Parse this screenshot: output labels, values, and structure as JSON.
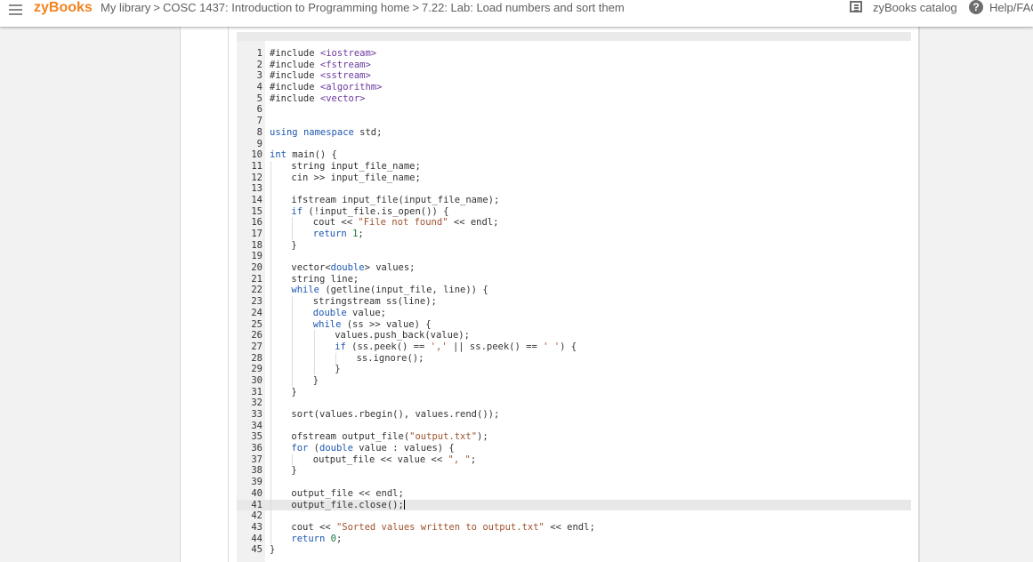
{
  "header": {
    "brand": "zyBooks",
    "breadcrumb": [
      {
        "label": "My library"
      },
      {
        "label": "COSC 1437: Introduction to Programming home"
      },
      {
        "label": "7.22: Lab: Load numbers and sort them"
      }
    ],
    "separator": ">",
    "catalog_label": "zyBooks catalog",
    "help_label": "Help/FAQ"
  },
  "colors": {
    "brand": "#f5821f",
    "keyword": "#1e57b0",
    "string": "#a0522d",
    "number": "#1a7a3a"
  },
  "editor": {
    "active_line": 41,
    "lines": [
      {
        "n": "1",
        "indent": 0,
        "tokens": [
          [
            "p",
            "#include "
          ],
          [
            "inc",
            "<iostream>"
          ]
        ]
      },
      {
        "n": "2",
        "indent": 0,
        "tokens": [
          [
            "p",
            "#include "
          ],
          [
            "inc",
            "<fstream>"
          ]
        ]
      },
      {
        "n": "3",
        "indent": 0,
        "tokens": [
          [
            "p",
            "#include "
          ],
          [
            "inc",
            "<sstream>"
          ]
        ]
      },
      {
        "n": "4",
        "indent": 0,
        "tokens": [
          [
            "p",
            "#include "
          ],
          [
            "inc",
            "<algorithm>"
          ]
        ]
      },
      {
        "n": "5",
        "indent": 0,
        "tokens": [
          [
            "p",
            "#include "
          ],
          [
            "inc",
            "<vector>"
          ]
        ]
      },
      {
        "n": "6",
        "indent": 0,
        "tokens": []
      },
      {
        "n": "7",
        "indent": 0,
        "tokens": []
      },
      {
        "n": "8",
        "indent": 0,
        "tokens": [
          [
            "kw",
            "using"
          ],
          [
            "p",
            " "
          ],
          [
            "kw",
            "namespace"
          ],
          [
            "p",
            " std;"
          ]
        ]
      },
      {
        "n": "9",
        "indent": 0,
        "tokens": []
      },
      {
        "n": "10",
        "indent": 0,
        "tokens": [
          [
            "kw",
            "int"
          ],
          [
            "p",
            " main() {"
          ]
        ]
      },
      {
        "n": "11",
        "indent": 1,
        "tokens": [
          [
            "p",
            "string input_file_name;"
          ]
        ]
      },
      {
        "n": "12",
        "indent": 1,
        "tokens": [
          [
            "p",
            "cin >> input_file_name;"
          ]
        ]
      },
      {
        "n": "13",
        "indent": 1,
        "tokens": []
      },
      {
        "n": "14",
        "indent": 1,
        "tokens": [
          [
            "p",
            "ifstream input_file(input_file_name);"
          ]
        ]
      },
      {
        "n": "15",
        "indent": 1,
        "tokens": [
          [
            "kw",
            "if"
          ],
          [
            "p",
            " (!input_file.is_open()) {"
          ]
        ]
      },
      {
        "n": "16",
        "indent": 2,
        "tokens": [
          [
            "p",
            "cout << "
          ],
          [
            "str",
            "\"File not found\""
          ],
          [
            "p",
            " << endl;"
          ]
        ]
      },
      {
        "n": "17",
        "indent": 2,
        "tokens": [
          [
            "kw",
            "return"
          ],
          [
            "p",
            " "
          ],
          [
            "num",
            "1"
          ],
          [
            "p",
            ";"
          ]
        ]
      },
      {
        "n": "18",
        "indent": 1,
        "tokens": [
          [
            "p",
            "}"
          ]
        ]
      },
      {
        "n": "19",
        "indent": 1,
        "tokens": []
      },
      {
        "n": "20",
        "indent": 1,
        "tokens": [
          [
            "p",
            "vector<"
          ],
          [
            "kw",
            "double"
          ],
          [
            "p",
            "> values;"
          ]
        ]
      },
      {
        "n": "21",
        "indent": 1,
        "tokens": [
          [
            "p",
            "string line;"
          ]
        ]
      },
      {
        "n": "22",
        "indent": 1,
        "tokens": [
          [
            "kw",
            "while"
          ],
          [
            "p",
            " (getline(input_file, line)) {"
          ]
        ]
      },
      {
        "n": "23",
        "indent": 2,
        "tokens": [
          [
            "p",
            "stringstream ss(line);"
          ]
        ]
      },
      {
        "n": "24",
        "indent": 2,
        "tokens": [
          [
            "kw",
            "double"
          ],
          [
            "p",
            " value;"
          ]
        ]
      },
      {
        "n": "25",
        "indent": 2,
        "tokens": [
          [
            "kw",
            "while"
          ],
          [
            "p",
            " (ss >> value) {"
          ]
        ]
      },
      {
        "n": "26",
        "indent": 3,
        "tokens": [
          [
            "p",
            "values.push_back(value);"
          ]
        ]
      },
      {
        "n": "27",
        "indent": 3,
        "tokens": [
          [
            "kw",
            "if"
          ],
          [
            "p",
            " (ss.peek() == "
          ],
          [
            "str",
            "','"
          ],
          [
            "p",
            " || ss.peek() == "
          ],
          [
            "str",
            "' '"
          ],
          [
            "p",
            ") {"
          ]
        ]
      },
      {
        "n": "28",
        "indent": 4,
        "tokens": [
          [
            "p",
            "ss.ignore();"
          ]
        ]
      },
      {
        "n": "29",
        "indent": 3,
        "tokens": [
          [
            "p",
            "}"
          ]
        ]
      },
      {
        "n": "30",
        "indent": 2,
        "tokens": [
          [
            "p",
            "}"
          ]
        ]
      },
      {
        "n": "31",
        "indent": 1,
        "tokens": [
          [
            "p",
            "}"
          ]
        ]
      },
      {
        "n": "32",
        "indent": 1,
        "tokens": []
      },
      {
        "n": "33",
        "indent": 1,
        "tokens": [
          [
            "p",
            "sort(values.rbegin(), values.rend());"
          ]
        ]
      },
      {
        "n": "34",
        "indent": 1,
        "tokens": []
      },
      {
        "n": "35",
        "indent": 1,
        "tokens": [
          [
            "p",
            "ofstream output_file("
          ],
          [
            "str",
            "\"output.txt\""
          ],
          [
            "p",
            ");"
          ]
        ]
      },
      {
        "n": "36",
        "indent": 1,
        "tokens": [
          [
            "kw",
            "for"
          ],
          [
            "p",
            " ("
          ],
          [
            "kw",
            "double"
          ],
          [
            "p",
            " value : values) {"
          ]
        ]
      },
      {
        "n": "37",
        "indent": 2,
        "tokens": [
          [
            "p",
            "output_file << value << "
          ],
          [
            "str",
            "\", \""
          ],
          [
            "p",
            ";"
          ]
        ]
      },
      {
        "n": "38",
        "indent": 1,
        "tokens": [
          [
            "p",
            "}"
          ]
        ]
      },
      {
        "n": "39",
        "indent": 1,
        "tokens": []
      },
      {
        "n": "40",
        "indent": 1,
        "tokens": [
          [
            "p",
            "output_file << endl;"
          ]
        ]
      },
      {
        "n": "41",
        "indent": 1,
        "tokens": [
          [
            "p",
            "output_file.close();"
          ]
        ]
      },
      {
        "n": "42",
        "indent": 1,
        "tokens": []
      },
      {
        "n": "43",
        "indent": 1,
        "tokens": [
          [
            "p",
            "cout << "
          ],
          [
            "str",
            "\"Sorted values written to output.txt\""
          ],
          [
            "p",
            " << endl;"
          ]
        ]
      },
      {
        "n": "44",
        "indent": 1,
        "tokens": [
          [
            "kw",
            "return"
          ],
          [
            "p",
            " "
          ],
          [
            "num",
            "0"
          ],
          [
            "p",
            ";"
          ]
        ]
      },
      {
        "n": "45",
        "indent": 0,
        "tokens": [
          [
            "p",
            "}"
          ]
        ]
      }
    ]
  }
}
